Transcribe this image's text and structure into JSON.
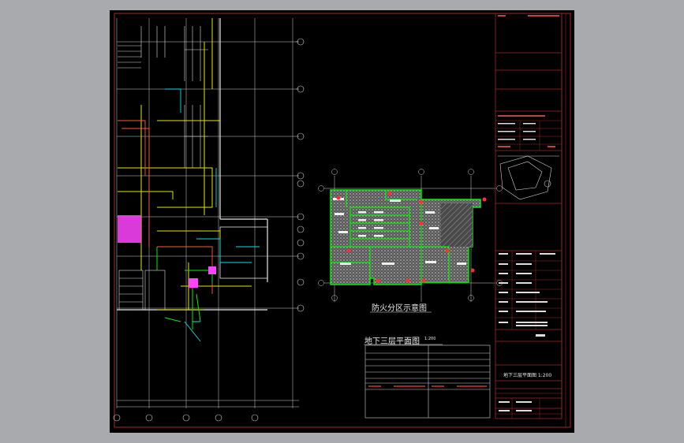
{
  "drawing": {
    "fire_zone_caption": "防火分区示意图",
    "plan_caption": "地下三层平面图",
    "plan_scale": "1:200",
    "tb_sheet_title": "地下三层平面图 1:200"
  },
  "colors": {
    "background": "#a9aaae",
    "sheet": "#000000",
    "border_red": "#9b2b2b",
    "zone_green": "#00ee00",
    "wall_yellow": "#e6e600",
    "duct_cyan": "#00e5e5",
    "equip_magenta": "#ff44ff",
    "line_white": "#e8e8e8"
  }
}
